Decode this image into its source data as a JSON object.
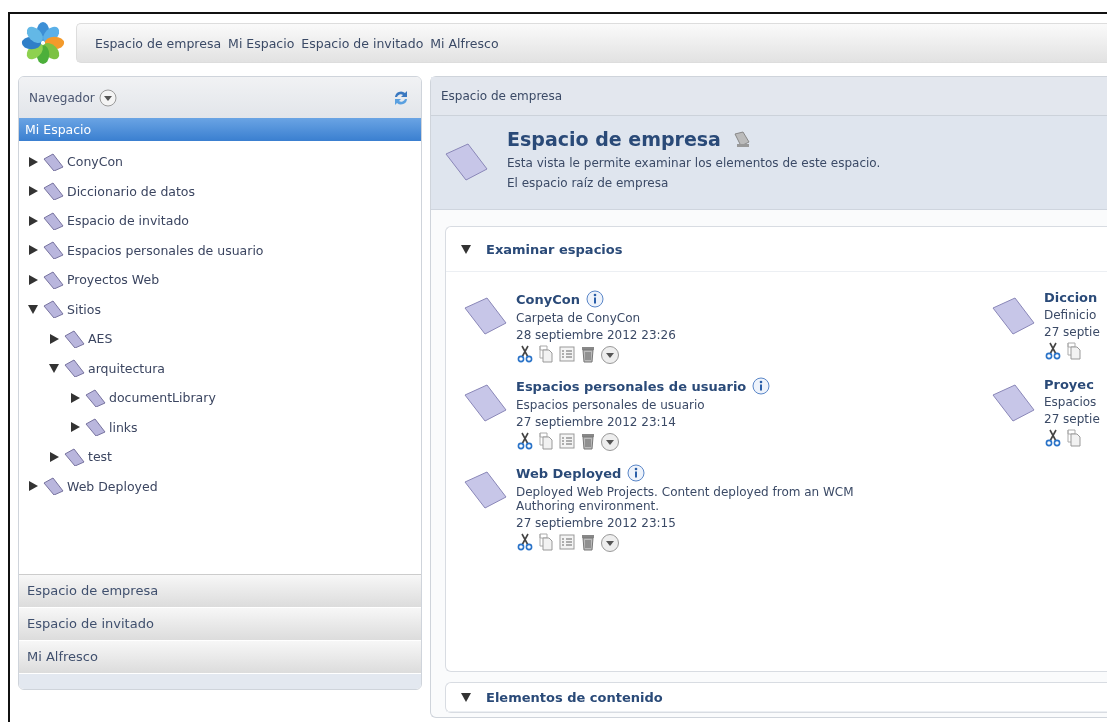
{
  "nav_bar": {
    "links": [
      "Espacio de empresa",
      "Mi Espacio",
      "Espacio de invitado",
      "Mi Alfresco"
    ]
  },
  "navigator": {
    "title": "Navegador",
    "selected_space": "Mi Espacio",
    "tree": [
      {
        "label": "ConyCon",
        "expanded": false
      },
      {
        "label": "Diccionario de datos",
        "expanded": false
      },
      {
        "label": "Espacio de invitado",
        "expanded": false
      },
      {
        "label": "Espacios personales de usuario",
        "expanded": false
      },
      {
        "label": "Proyectos Web",
        "expanded": false
      },
      {
        "label": "Sitios",
        "expanded": true,
        "children": [
          {
            "label": "AES",
            "expanded": false
          },
          {
            "label": "arquitectura",
            "expanded": true,
            "children": [
              {
                "label": "documentLibrary",
                "expanded": false
              },
              {
                "label": "links",
                "expanded": false
              }
            ]
          },
          {
            "label": "test",
            "expanded": false
          }
        ]
      },
      {
        "label": "Web Deployed",
        "expanded": false
      }
    ],
    "accordion": [
      "Espacio de empresa",
      "Espacio de invitado",
      "Mi Alfresco"
    ]
  },
  "breadcrumb": "Espacio de empresa",
  "space_header": {
    "title": "Espacio de empresa",
    "description": "Esta vista le permite examinar los elementos de este espacio.",
    "subtitle": "El espacio raíz de empresa"
  },
  "sections": [
    {
      "title": "Examinar espacios",
      "expanded": true,
      "items": [
        {
          "name": "ConyCon",
          "info_icon": true,
          "description": "Carpeta de ConyCon",
          "date": "28 septiembre 2012 23:26",
          "actions": [
            {
              "kind": "cut"
            },
            {
              "kind": "copy"
            },
            {
              "kind": "details"
            },
            {
              "kind": "delete"
            },
            {
              "kind": "more"
            }
          ]
        },
        {
          "name": "Diccion",
          "info_icon": false,
          "description": "Definicio",
          "date": "27 septie",
          "actions": [
            {
              "kind": "cut"
            },
            {
              "kind": "copy"
            }
          ]
        },
        {
          "name": "Espacios personales de usuario",
          "info_icon": true,
          "description": "Espacios personales de usuario",
          "date": "27 septiembre 2012 23:14",
          "actions": [
            {
              "kind": "cut"
            },
            {
              "kind": "copy"
            },
            {
              "kind": "details"
            },
            {
              "kind": "delete"
            },
            {
              "kind": "more"
            }
          ]
        },
        {
          "name": "Proyec",
          "info_icon": false,
          "description": "Espacios",
          "date": "27 septie",
          "actions": [
            {
              "kind": "cut"
            },
            {
              "kind": "copy"
            }
          ]
        },
        {
          "name": "Web Deployed",
          "info_icon": true,
          "description": "Deployed Web Projects. Content deployed from an WCM Authoring environment.",
          "date": "27 septiembre 2012 23:15",
          "actions": [
            {
              "kind": "cut"
            },
            {
              "kind": "copy"
            },
            {
              "kind": "details"
            },
            {
              "kind": "delete"
            },
            {
              "kind": "more"
            }
          ]
        }
      ]
    },
    {
      "title": "Elementos de contenido",
      "expanded": true
    }
  ]
}
